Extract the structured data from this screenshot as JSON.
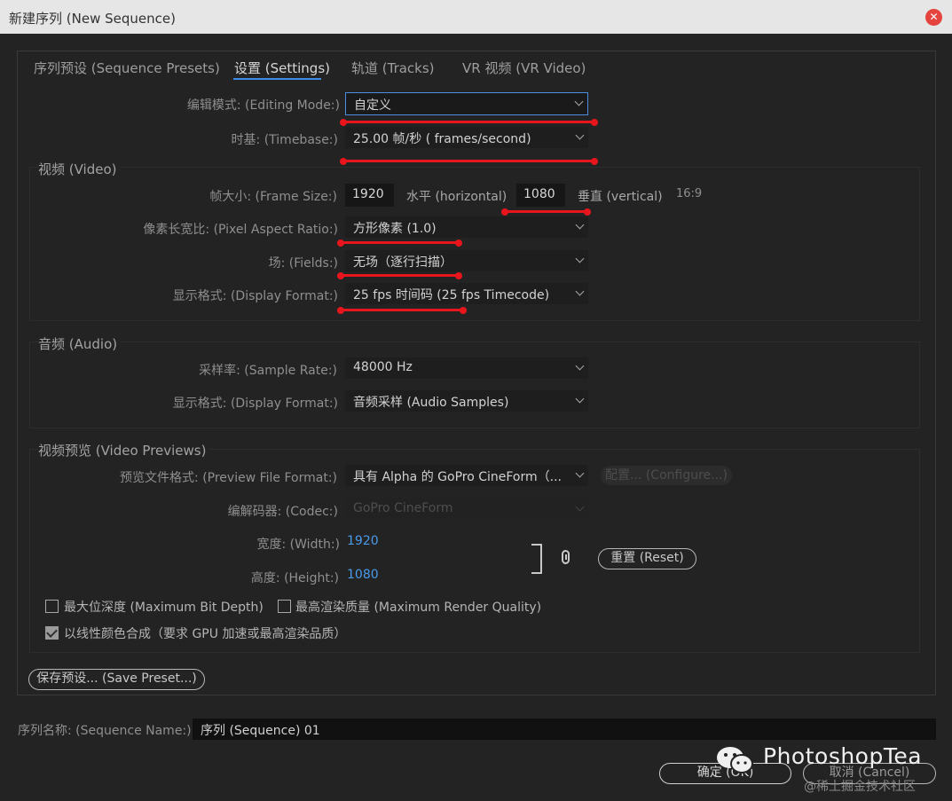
{
  "window": {
    "title": "新建序列 (New Sequence)",
    "close_symbol": "✕"
  },
  "tabs": [
    {
      "label": "序列预设 (Sequence Presets)",
      "active": false
    },
    {
      "label": "设置 (Settings)",
      "active": true
    },
    {
      "label": "轨道 (Tracks)",
      "active": false
    },
    {
      "label": "VR 视频 (VR Video)",
      "active": false
    }
  ],
  "general": {
    "editing_mode": {
      "label": "编辑模式: (Editing Mode:)",
      "value": "自定义"
    },
    "timebase": {
      "label": "时基: (Timebase:)",
      "value": "25.00  帧/秒 ( frames/second)"
    }
  },
  "video": {
    "title": "视频 (Video)",
    "frame_size": {
      "label": "帧大小: (Frame Size:)",
      "width": "1920",
      "horizontal_label": "水平 (horizontal)",
      "height": "1080",
      "vertical_label": "垂直 (vertical)",
      "ratio": "16:9"
    },
    "pixel_aspect_ratio": {
      "label": "像素长宽比: (Pixel Aspect Ratio:)",
      "value": "方形像素 (1.0)"
    },
    "fields": {
      "label": "场: (Fields:)",
      "value": "无场（逐行扫描）"
    },
    "display_format": {
      "label": "显示格式: (Display Format:)",
      "value": "25 fps 时间码 (25 fps Timecode)"
    }
  },
  "audio": {
    "title": "音频 (Audio)",
    "sample_rate": {
      "label": "采样率: (Sample Rate:)",
      "value": "48000 Hz"
    },
    "display_format": {
      "label": "显示格式: (Display Format:)",
      "value": "音频采样 (Audio Samples)"
    }
  },
  "video_previews": {
    "title": "视频预览 (Video Previews)",
    "preview_file_format": {
      "label": "预览文件格式: (Preview File Format:)",
      "value": "具有 Alpha 的 GoPro CineForm（..."
    },
    "configure_label": "配置... (Configure...)",
    "codec": {
      "label": "编解码器: (Codec:)",
      "value": "GoPro CineForm"
    },
    "width": {
      "label": "宽度: (Width:)",
      "value": "1920"
    },
    "height": {
      "label": "高度: (Height:)",
      "value": "1080"
    },
    "reset_label": "重置 (Reset)",
    "max_bit_depth": {
      "label": "最大位深度 (Maximum Bit Depth)",
      "checked": false
    },
    "max_render_quality": {
      "label": "最高渲染质量 (Maximum Render Quality)",
      "checked": false
    },
    "linear_color": {
      "label": "以线性颜色合成（要求 GPU 加速或最高渲染品质）",
      "checked": true
    }
  },
  "save_preset_label": "保存预设... (Save Preset...)",
  "sequence_name": {
    "label": "序列名称: (Sequence Name:)",
    "value": "序列 (Sequence) 01"
  },
  "buttons": {
    "ok": "确定 (OK)",
    "cancel": "取消 (Cancel)"
  },
  "watermark": {
    "brand": "PhotoshopTea",
    "community": "@稀土掘金技术社区"
  },
  "colors": {
    "accent": "#3c8be8",
    "annotation": "#e8161c",
    "value_blue": "#4a9ae8",
    "close": "#e4443d"
  }
}
